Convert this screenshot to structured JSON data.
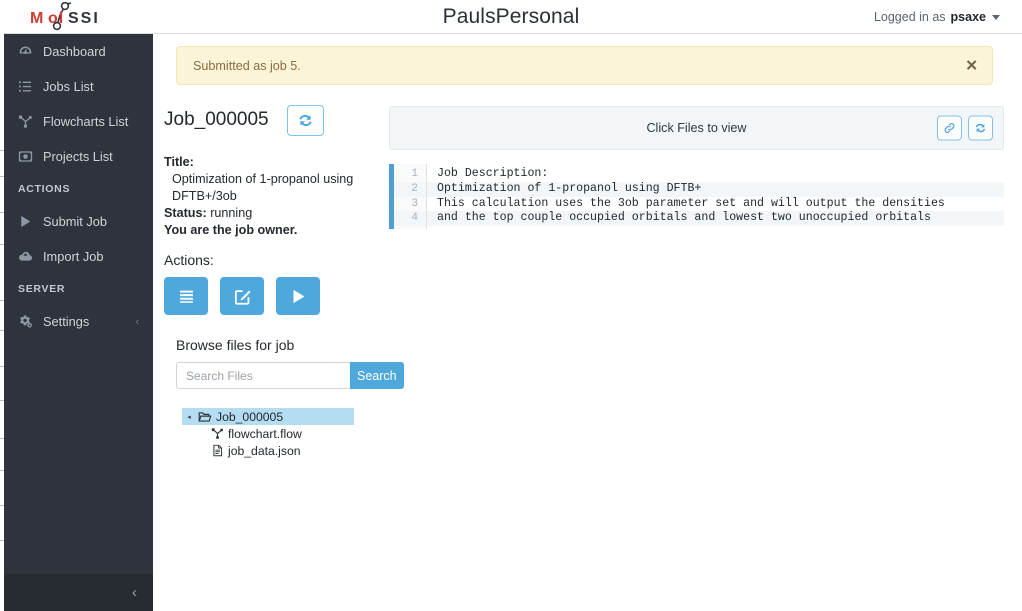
{
  "header": {
    "brand_name": "MolSSI",
    "brand_mark": "molssi-logo",
    "title": "PaulsPersonal",
    "logged_in_prefix": "Logged in as",
    "username": "psaxe"
  },
  "sidebar": {
    "items": [
      {
        "label": "Dashboard",
        "icon": "dashboard-icon",
        "name": "sidebar-item-dashboard"
      },
      {
        "label": "Jobs List",
        "icon": "list-icon",
        "name": "sidebar-item-jobs-list"
      },
      {
        "label": "Flowcharts List",
        "icon": "sitemap-icon",
        "name": "sidebar-item-flowcharts-list"
      },
      {
        "label": "Projects List",
        "icon": "project-icon",
        "name": "sidebar-item-projects-list"
      }
    ],
    "section_actions": "ACTIONS",
    "action_items": [
      {
        "label": "Submit Job",
        "icon": "play-icon",
        "name": "sidebar-item-submit-job"
      },
      {
        "label": "Import Job",
        "icon": "upload-cloud-icon",
        "name": "sidebar-item-import-job"
      }
    ],
    "section_server": "SERVER",
    "server_items": [
      {
        "label": "Settings",
        "icon": "gears-icon",
        "name": "sidebar-item-settings",
        "chevron": "‹"
      }
    ],
    "collapse_glyph": "‹"
  },
  "alert": {
    "message": "Submitted as job 5.",
    "close_glyph": "✕",
    "bg_color": "#fcf4d8",
    "text_color": "#8a6d3b"
  },
  "job": {
    "id": "Job_000005",
    "refresh_icon": "refresh-icon",
    "title_label": "Title:",
    "title_value": "Optimization of 1-propanol using DFTB+/3ob",
    "status_label": "Status:",
    "status_value": "running",
    "owner_note": "You are the job owner.",
    "actions_label": "Actions:",
    "action_buttons": [
      {
        "name": "job-details-button",
        "icon": "lines-icon"
      },
      {
        "name": "job-edit-button",
        "icon": "edit-square-icon"
      },
      {
        "name": "job-run-button",
        "icon": "play-icon"
      }
    ],
    "browse_label": "Browse files for job",
    "search_placeholder": "Search Files",
    "search_value": "",
    "search_button": "Search",
    "accent_color": "#4fa8dc"
  },
  "file_tree": {
    "root": {
      "label": "Job_000005",
      "icon": "folder-open-icon",
      "selected": true,
      "arrow": "◂"
    },
    "children": [
      {
        "label": "flowchart.flow",
        "icon": "sitemap-icon"
      },
      {
        "label": "job_data.json",
        "icon": "file-icon"
      }
    ]
  },
  "viewer": {
    "header_title": "Click Files to view",
    "buttons": [
      {
        "name": "copy-link-button",
        "icon": "link-icon"
      },
      {
        "name": "viewer-refresh-button",
        "icon": "refresh-icon"
      }
    ],
    "line_numbers": [
      "1",
      "2",
      "3",
      "4"
    ],
    "lines": [
      "Job Description:",
      "Optimization of 1-propanol using DFTB+",
      "This calculation uses the 3ob parameter set and will output the densities",
      "and the top couple occupied orbitals and lowest two unoccupied orbitals"
    ],
    "accent_color": "#4d9fd6"
  }
}
